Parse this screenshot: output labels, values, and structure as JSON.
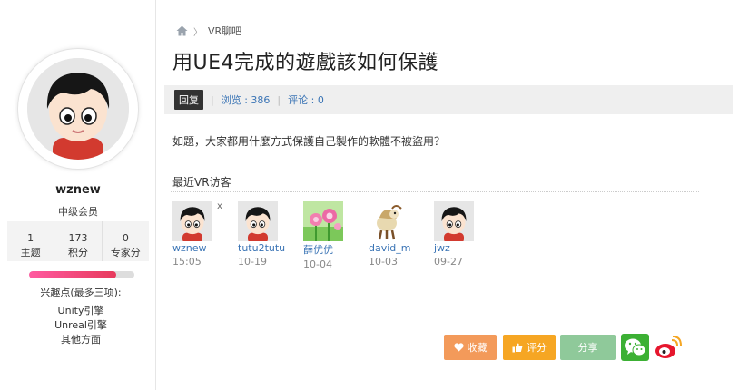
{
  "profile": {
    "username": "wznew",
    "level": "中级会员",
    "stats": [
      {
        "value": "1",
        "label": "主题"
      },
      {
        "value": "173",
        "label": "积分"
      },
      {
        "value": "0",
        "label": "专家分"
      }
    ],
    "progress": 0.83,
    "hobbies_title": "兴趣点(最多三项):",
    "hobbies": [
      "Unity引擎",
      "Unreal引擎",
      "其他方面"
    ]
  },
  "breadcrumb": {
    "section": "VR聊吧"
  },
  "thread": {
    "title": "用UE4完成的遊戲該如何保護",
    "reply_label": "回复",
    "views_label": "浏览 : 386",
    "comments_label": "评论 : 0",
    "body": "如題，大家都用什麼方式保護自己製作的軟體不被盜用？"
  },
  "visitors": {
    "title": "最近VR访客",
    "close_mark": "x",
    "items": [
      {
        "name": "wznew",
        "date": "15:05"
      },
      {
        "name": "tutu2tutu",
        "date": "10-19"
      },
      {
        "name": "薛优优",
        "date": "10-04"
      },
      {
        "name": "david_m",
        "date": "10-03"
      },
      {
        "name": "jwz",
        "date": "09-27"
      }
    ]
  },
  "actions": {
    "favorite": "收藏",
    "rate": "评分",
    "share": "分享"
  },
  "colors": {
    "favorite": "#f39a5a",
    "rate": "#f6a623",
    "share": "#8fc99a",
    "wechat": "#3cb034",
    "weibo": "#e6162d",
    "link": "#3a74b5"
  }
}
